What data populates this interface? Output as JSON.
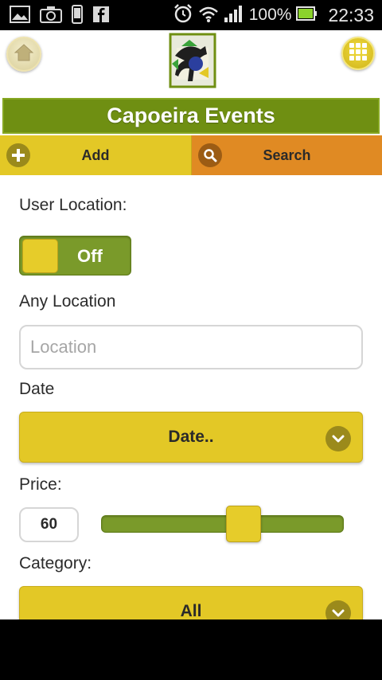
{
  "status_bar": {
    "left_icons": [
      "gallery-icon",
      "camera-icon",
      "phone-icon",
      "facebook-icon"
    ],
    "right_icons": [
      "alarm-icon",
      "wifi-icon",
      "signal-icon"
    ],
    "battery_percent": "100%",
    "battery_level": 1.0,
    "time": "22:33"
  },
  "header": {
    "home_icon": "home-icon",
    "menu_icon": "grid-menu-icon",
    "logo": "capoeira-logo"
  },
  "title": "Capoeira Events",
  "tabs": [
    {
      "label": "Add",
      "icon": "plus-icon"
    },
    {
      "label": "Search",
      "icon": "search-icon"
    }
  ],
  "form": {
    "user_location_label": "User Location:",
    "toggle_state": "Off",
    "any_location_label": "Any Location",
    "location_placeholder": "Location",
    "location_value": "",
    "date_label": "Date",
    "date_select": "Date..",
    "price_label": "Price:",
    "price_value": "60",
    "price_slider_fraction": 0.6,
    "category_label": "Category:",
    "category_select": "All"
  },
  "colors": {
    "accent_green": "#6f8f12",
    "accent_yellow": "#e3c826",
    "accent_orange": "#e08a23"
  }
}
